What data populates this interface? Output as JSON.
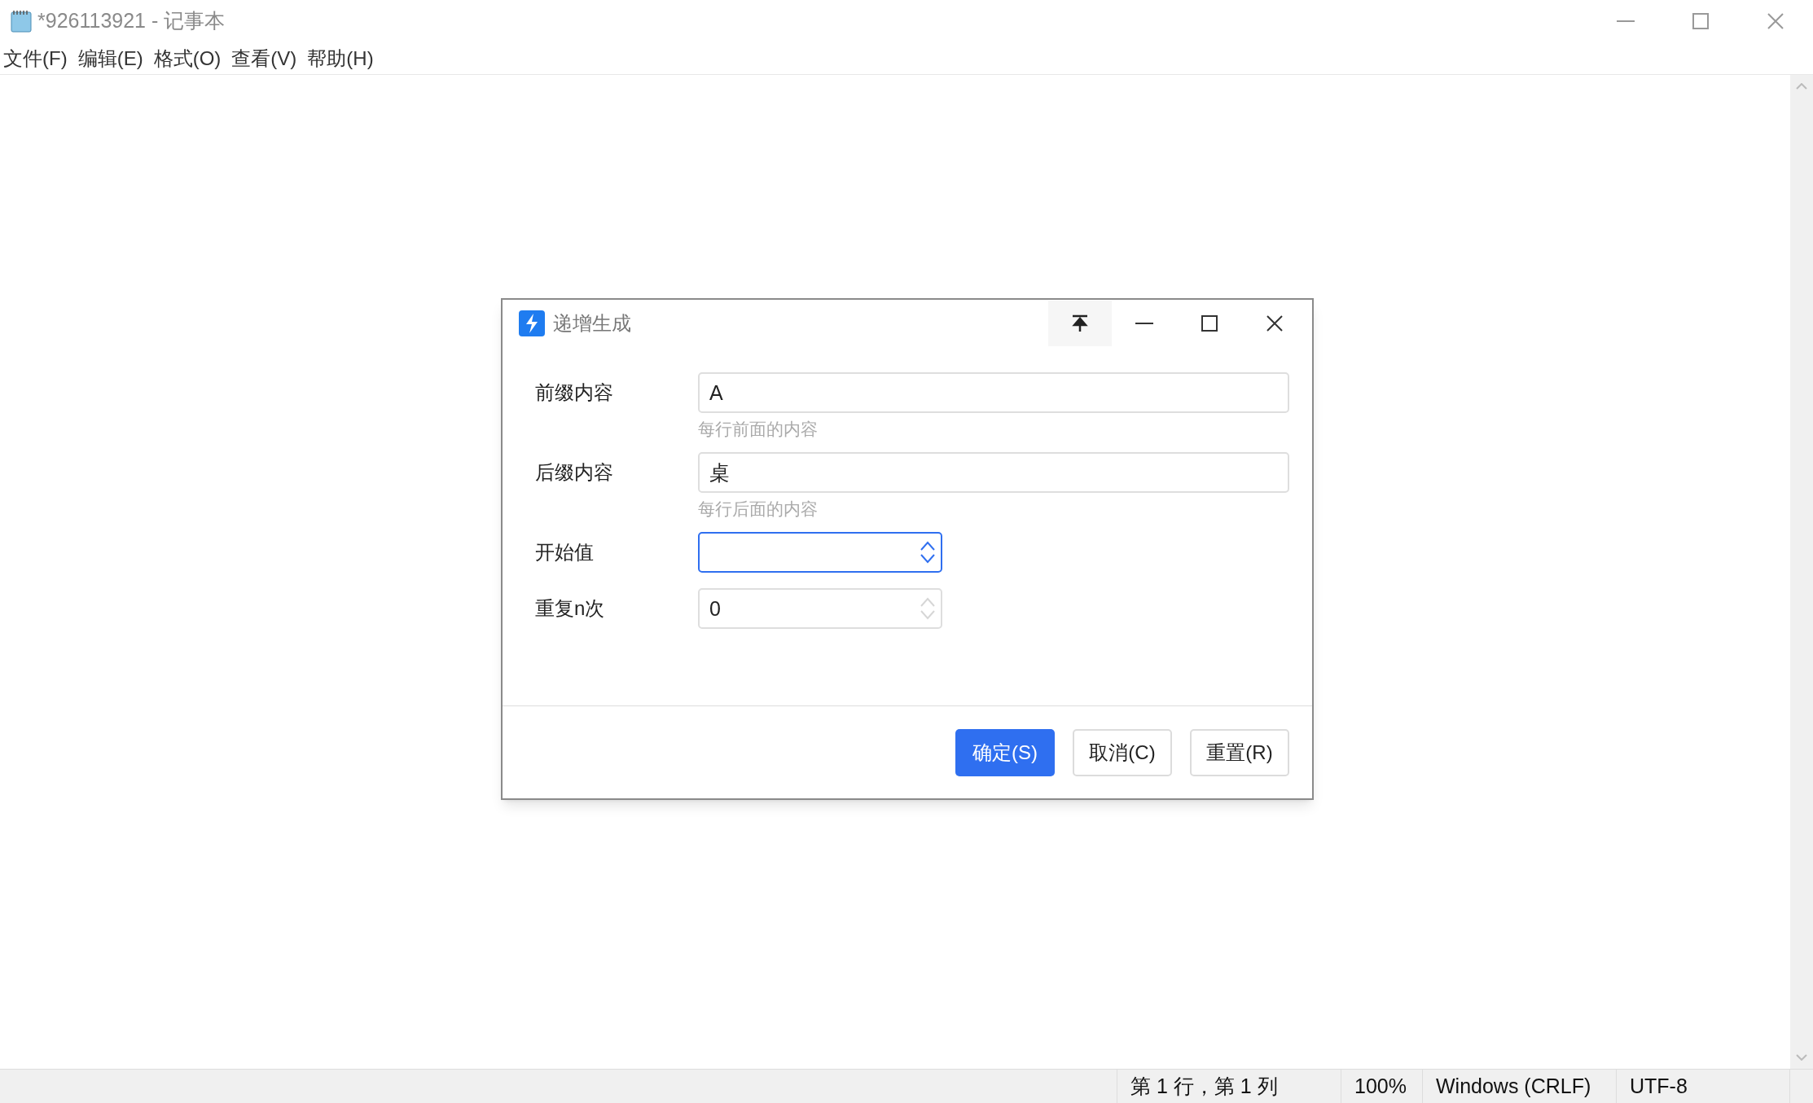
{
  "window": {
    "title": "*926113921 - 记事本"
  },
  "menu": [
    "文件(F)",
    "编辑(E)",
    "格式(O)",
    "查看(V)",
    "帮助(H)"
  ],
  "dialog": {
    "title": "递增生成",
    "fields": [
      {
        "kind": "text",
        "label": "前缀内容",
        "value": "A",
        "hint": "每行前面的内容",
        "focused": false
      },
      {
        "kind": "text",
        "label": "后缀内容",
        "value": "桌",
        "hint": "每行后面的内容",
        "focused": false
      },
      {
        "kind": "number",
        "label": "开始值",
        "focused": true
      },
      {
        "kind": "number",
        "label": "重复n次",
        "value": "0",
        "focused": false
      }
    ],
    "buttons": [
      {
        "label": "确定(S)",
        "primary": true
      },
      {
        "label": "取消(C)",
        "primary": false
      },
      {
        "label": "重置(R)",
        "primary": false
      }
    ]
  },
  "status_bar": [
    "第 1 行，第 1 列",
    "100%",
    "Windows (CRLF)",
    "UTF-8"
  ]
}
